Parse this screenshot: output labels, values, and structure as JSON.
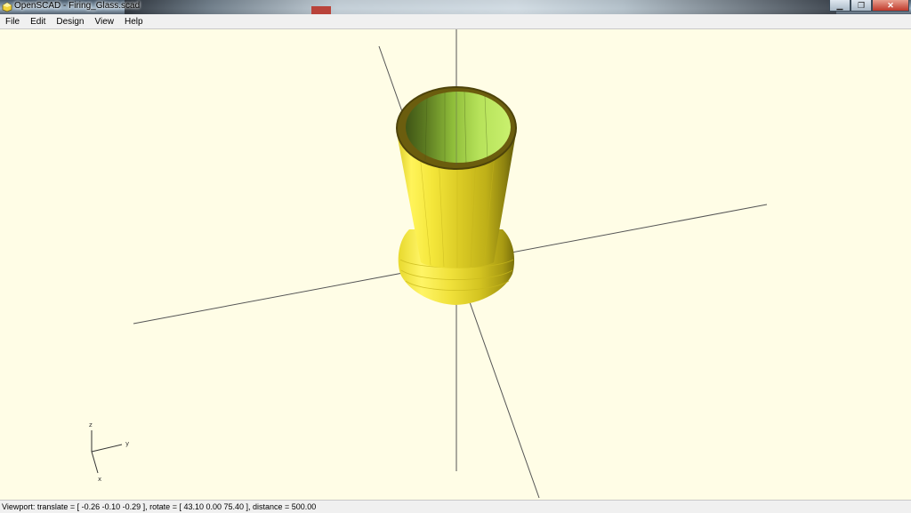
{
  "window": {
    "title": "OpenSCAD - Firing_Glass.scad",
    "controls": {
      "minimize": "▁",
      "maximize": "❐",
      "close": "✕"
    }
  },
  "menubar": {
    "items": [
      {
        "key": "file",
        "label": "File"
      },
      {
        "key": "edit",
        "label": "Edit"
      },
      {
        "key": "design",
        "label": "Design"
      },
      {
        "key": "view",
        "label": "View"
      },
      {
        "key": "help",
        "label": "Help"
      }
    ]
  },
  "viewport": {
    "background_color": "#fffde6",
    "model_color": "#f5e93b",
    "axis_indicator": {
      "x": "x",
      "y": "y",
      "z": "z"
    }
  },
  "statusbar": {
    "text": "Viewport: translate = [ -0.26 -0.10 -0.29 ], rotate = [ 43.10 0.00 75.40 ], distance = 500.00"
  }
}
